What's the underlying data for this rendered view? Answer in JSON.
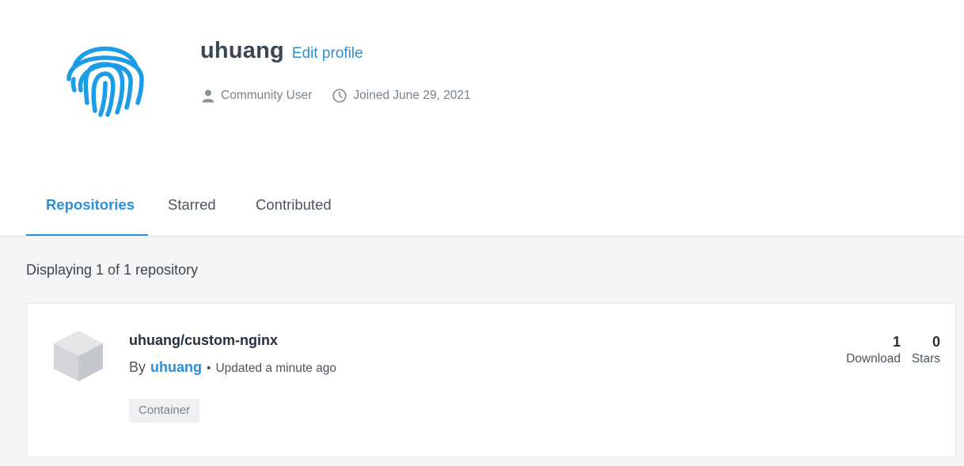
{
  "profile": {
    "avatar_icon": "fingerprint-icon",
    "username": "uhuang",
    "edit_profile_label": "Edit profile",
    "role_icon": "user-icon",
    "role": "Community User",
    "joined_icon": "clock-icon",
    "joined": "Joined June 29, 2021"
  },
  "tabs": [
    {
      "label": "Repositories",
      "active": true
    },
    {
      "label": "Starred",
      "active": false
    },
    {
      "label": "Contributed",
      "active": false
    }
  ],
  "content": {
    "displaying": "Displaying 1 of 1 repository",
    "repositories": [
      {
        "icon": "cube-icon",
        "name": "uhuang/custom-nginx",
        "by_label": "By",
        "owner": "uhuang",
        "separator": "•",
        "updated": "Updated a minute ago",
        "tag": "Container",
        "downloads_value": "1",
        "downloads_label": "Download",
        "stars_value": "0",
        "stars_label": "Stars"
      }
    ]
  },
  "colors": {
    "accent": "#2b8fdc",
    "avatar": "#1c9be6",
    "text": "#27313b",
    "muted": "#7a828b",
    "content_bg": "#f5f5f5",
    "tag_bg": "#eef0f3"
  }
}
